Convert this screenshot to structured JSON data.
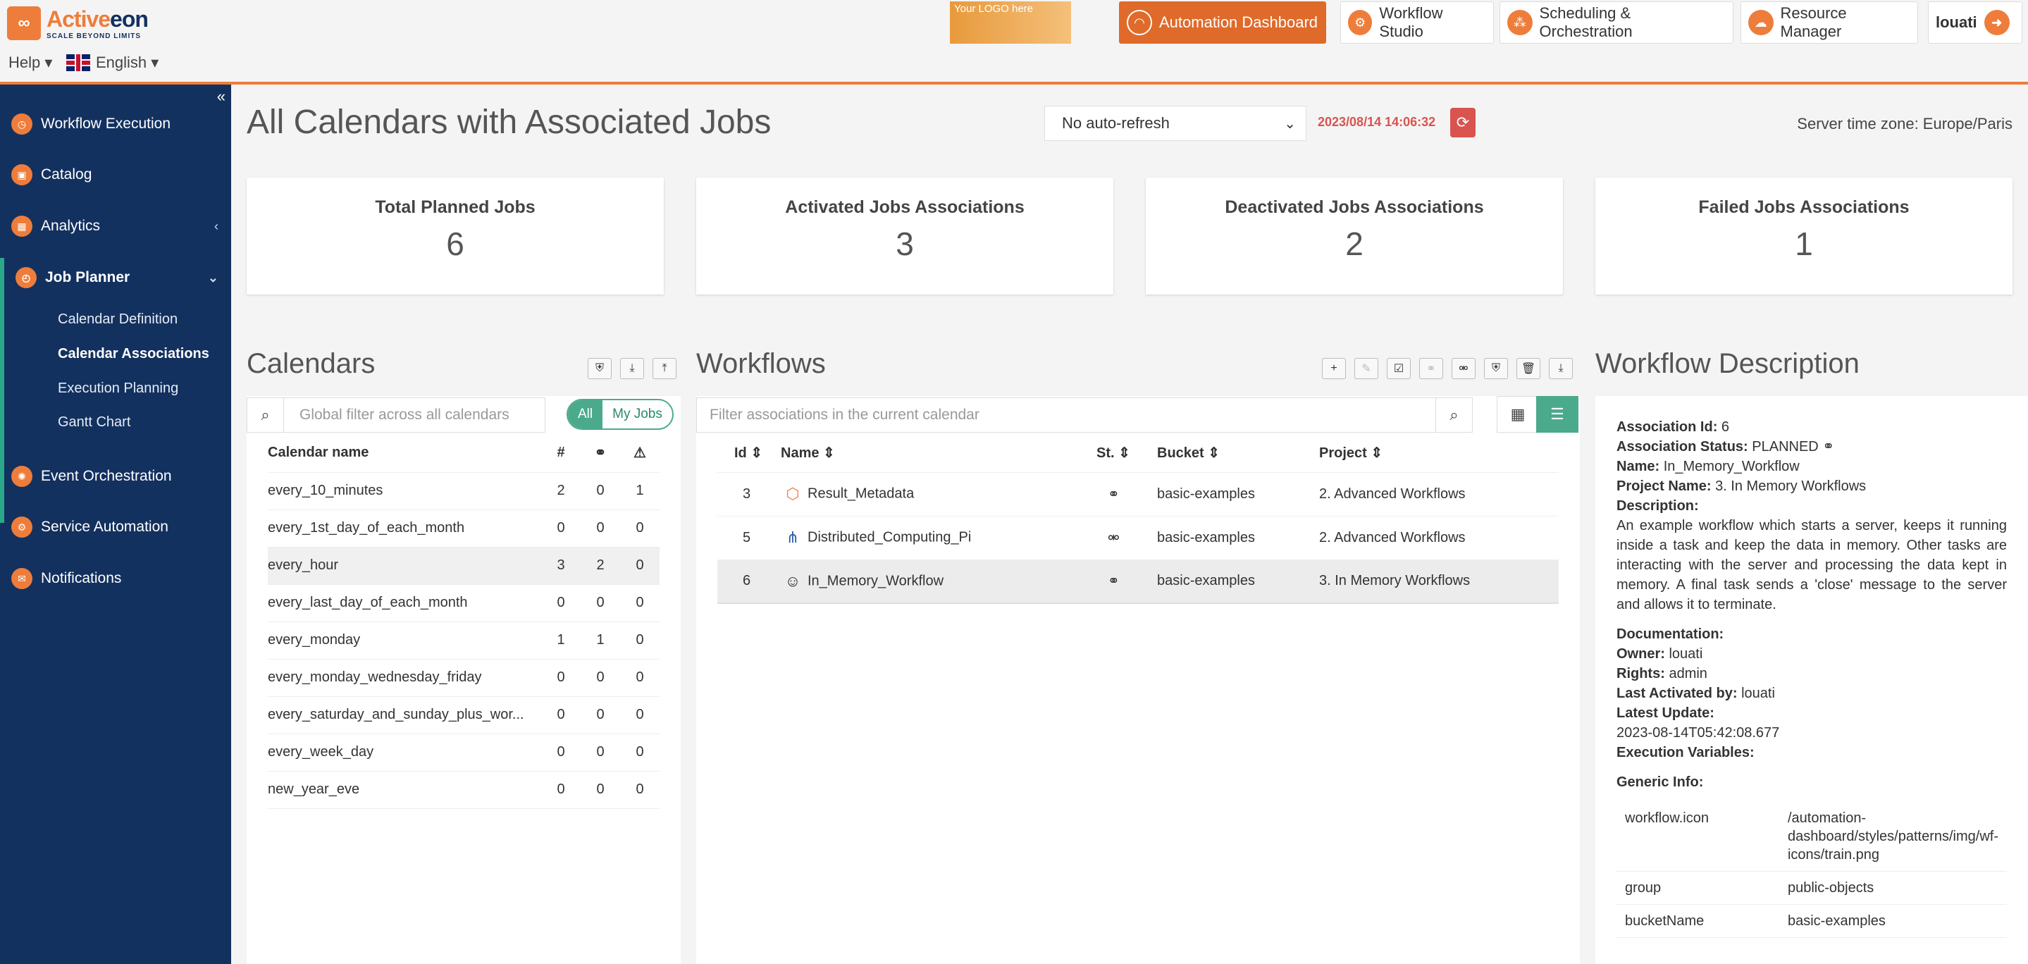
{
  "header": {
    "logo_name_a": "Active",
    "logo_name_b": "eon",
    "logo_tagline": "SCALE BEYOND LIMITS",
    "help": "Help ▾",
    "language": "English ▾",
    "your_logo": "Your LOGO here",
    "nav": [
      {
        "label": "Automation Dashboard",
        "icon": "gauge-icon",
        "active": true
      },
      {
        "label": "Workflow Studio",
        "icon": "studio-icon"
      },
      {
        "label": "Scheduling & Orchestration",
        "icon": "scheduling-icon"
      },
      {
        "label": "Resource Manager",
        "icon": "resource-icon"
      }
    ],
    "user": "louati"
  },
  "sidebar": {
    "items": [
      {
        "label": "Workflow Execution"
      },
      {
        "label": "Catalog"
      },
      {
        "label": "Analytics"
      },
      {
        "label": "Job Planner"
      },
      {
        "label": "Event Orchestration"
      },
      {
        "label": "Service Automation"
      },
      {
        "label": "Notifications"
      }
    ],
    "subitems": [
      "Calendar Definition",
      "Calendar Associations",
      "Execution Planning",
      "Gantt Chart"
    ]
  },
  "page": {
    "title": "All Calendars with Associated Jobs",
    "refresh_option": "No auto-refresh",
    "timestamp": "2023/08/14 14:06:32",
    "timezone": "Server time zone: Europe/Paris"
  },
  "cards": [
    {
      "title": "Total Planned Jobs",
      "value": "6"
    },
    {
      "title": "Activated Jobs Associations",
      "value": "3"
    },
    {
      "title": "Deactivated Jobs Associations",
      "value": "2"
    },
    {
      "title": "Failed Jobs Associations",
      "value": "1"
    }
  ],
  "calendars": {
    "title": "Calendars",
    "filter_placeholder": "Global filter across all calendars",
    "toggle_all": "All",
    "toggle_mine": "My Jobs",
    "headers": {
      "name": "Calendar name",
      "count": "#"
    },
    "rows": [
      {
        "name": "every_10_minutes",
        "c": "2",
        "l": "0",
        "w": "1"
      },
      {
        "name": "every_1st_day_of_each_month",
        "c": "0",
        "l": "0",
        "w": "0"
      },
      {
        "name": "every_hour",
        "c": "3",
        "l": "2",
        "w": "0"
      },
      {
        "name": "every_last_day_of_each_month",
        "c": "0",
        "l": "0",
        "w": "0"
      },
      {
        "name": "every_monday",
        "c": "1",
        "l": "1",
        "w": "0"
      },
      {
        "name": "every_monday_wednesday_friday",
        "c": "0",
        "l": "0",
        "w": "0"
      },
      {
        "name": "every_saturday_and_sunday_plus_wor...",
        "c": "0",
        "l": "0",
        "w": "0"
      },
      {
        "name": "every_week_day",
        "c": "0",
        "l": "0",
        "w": "0"
      },
      {
        "name": "new_year_eve",
        "c": "0",
        "l": "0",
        "w": "0"
      }
    ]
  },
  "workflows": {
    "title": "Workflows",
    "filter_placeholder": "Filter associations in the current calendar",
    "headers": {
      "id": "Id ⇕",
      "name": "Name ⇕",
      "st": "St. ⇕",
      "bucket": "Bucket ⇕",
      "project": "Project ⇕"
    },
    "rows": [
      {
        "id": "3",
        "name": "Result_Metadata",
        "icon": "cube-icon",
        "status_icon": "link-icon",
        "bucket": "basic-examples",
        "project": "2. Advanced Workflows"
      },
      {
        "id": "5",
        "name": "Distributed_Computing_Pi",
        "icon": "distributed-icon",
        "status_icon": "broken-link-icon",
        "bucket": "basic-examples",
        "project": "2. Advanced Workflows"
      },
      {
        "id": "6",
        "name": "In_Memory_Workflow",
        "icon": "brain-icon",
        "status_icon": "link-icon",
        "bucket": "basic-examples",
        "project": "3. In Memory Workflows"
      }
    ]
  },
  "description": {
    "title": "Workflow Description",
    "assoc_id_label": "Association Id:",
    "assoc_id": "6",
    "status_label": "Association Status:",
    "status": "PLANNED",
    "name_label": "Name:",
    "name": "In_Memory_Workflow",
    "project_label": "Project Name:",
    "project": "3. In Memory Workflows",
    "desc_label": "Description:",
    "desc_text": "An example workflow which starts a server, keeps it running inside a task and keep the data in memory. Other tasks are interacting with the server and processing the data kept in memory. A final task sends a 'close' message to the server and allows it to terminate.",
    "doc_label": "Documentation:",
    "owner_label": "Owner:",
    "owner": "louati",
    "rights_label": "Rights:",
    "rights": "admin",
    "last_activated_label": "Last Activated by:",
    "last_activated": "louati",
    "latest_update_label": "Latest Update:",
    "latest_update": "2023-08-14T05:42:08.677",
    "exec_vars_label": "Execution Variables:",
    "generic_label": "Generic Info:",
    "generic": [
      {
        "key": "workflow.icon",
        "value": "/automation-dashboard/styles/patterns/img/wf-icons/train.png"
      },
      {
        "key": "group",
        "value": "public-objects"
      },
      {
        "key": "bucketName",
        "value": "basic-examples"
      }
    ]
  },
  "colors": {
    "brand": "#ee7d3b",
    "sidebar": "#13315f",
    "accent": "#4caa8c",
    "danger": "#d9534f"
  }
}
